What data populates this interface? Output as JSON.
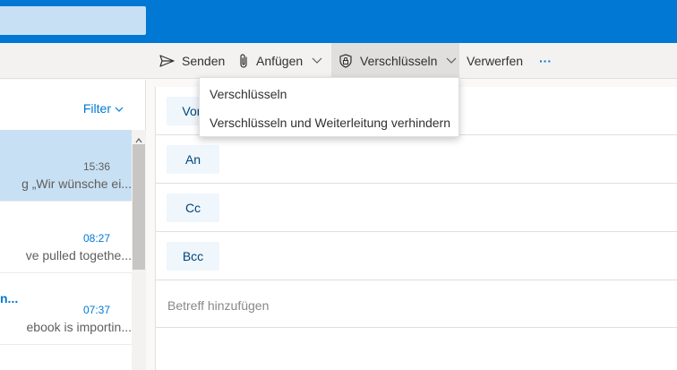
{
  "toolbar": {
    "send_label": "Senden",
    "attach_label": "Anfügen",
    "encrypt_label": "Verschlüsseln",
    "discard_label": "Verwerfen",
    "more_label": "···"
  },
  "encrypt_menu": {
    "items": [
      {
        "label": "Verschlüsseln"
      },
      {
        "label": "Verschlüsseln und Weiterleitung verhindern"
      }
    ]
  },
  "message_list": {
    "filter_label": "Filter",
    "messages": [
      {
        "sender": "",
        "time": "15:36",
        "preview": "g „Wir wünsche ei...",
        "selected": true,
        "unread": false
      },
      {
        "sender": "",
        "time": "08:27",
        "preview": "ve pulled togethe...",
        "selected": false,
        "unread": true
      },
      {
        "sender": "n...",
        "time": "07:37",
        "preview": "ebook is importin...",
        "selected": false,
        "unread": true
      }
    ]
  },
  "compose": {
    "from_label": "Von",
    "to_label": "An",
    "cc_label": "Cc",
    "bcc_label": "Bcc",
    "subject_placeholder": "Betreff hinzufügen"
  },
  "colors": {
    "brand": "#0078d4",
    "selected_bg": "#c7e0f4",
    "field_button_bg": "#eff6fc"
  }
}
